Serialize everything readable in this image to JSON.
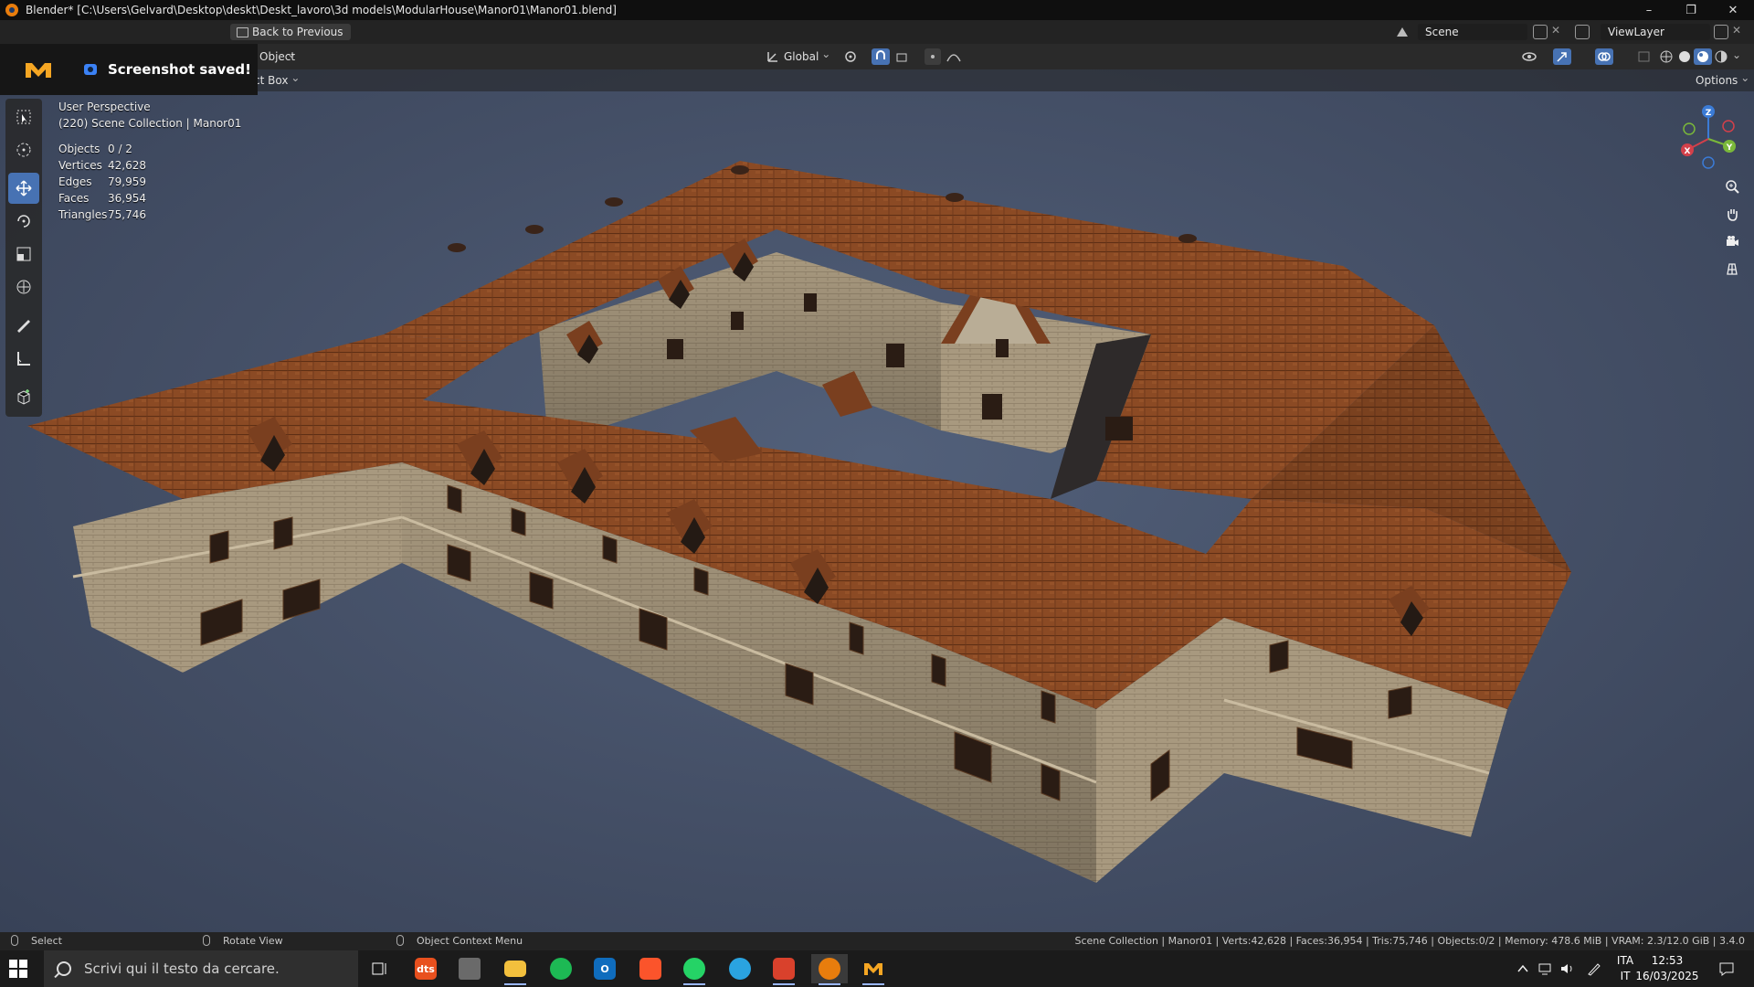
{
  "window": {
    "title": "Blender* [C:\\Users\\Gelvard\\Desktop\\deskt\\Deskt_lavoro\\3d models\\ModularHouse\\Manor01\\Manor01.blend]",
    "minimize": "–",
    "restore": "❐",
    "close": "✕"
  },
  "header": {
    "back_button": "Back to Previous",
    "scene_label": "Scene",
    "view_layer_label": "ViewLayer"
  },
  "viewport_header": {
    "mode": "Object",
    "transform_orientation": "Global",
    "select_box": "ct Box",
    "options": "Options"
  },
  "toast": {
    "message": "Screenshot saved!"
  },
  "overlay": {
    "view_name": "User Perspective",
    "collection": "(220) Scene Collection | Manor01"
  },
  "stats": [
    {
      "key": "Objects",
      "value": "0 / 2"
    },
    {
      "key": "Vertices",
      "value": "42,628"
    },
    {
      "key": "Edges",
      "value": "79,959"
    },
    {
      "key": "Faces",
      "value": "36,954"
    },
    {
      "key": "Triangles",
      "value": "75,746"
    }
  ],
  "gizmo": {
    "x": "X",
    "y": "Y",
    "z": "Z"
  },
  "statusbar": {
    "select": "Select",
    "rotate_view": "Rotate View",
    "context_menu": "Object Context Menu",
    "info": "Scene Collection | Manor01 | Verts:42,628 | Faces:36,954 | Tris:75,746 | Objects:0/2 | Memory: 478.6 MiB | VRAM: 2.3/12.0 GiB | 3.4.0"
  },
  "taskbar": {
    "search_placeholder": "Scrivi qui il testo da cercare.",
    "lang_top": "ITA",
    "lang_bottom": "IT",
    "time": "12:53",
    "date": "16/03/2025"
  },
  "colors": {
    "accent_blue": "#4772b3",
    "roof": "#8a4a25",
    "wall": "#a89880",
    "viewport_bg": "#4a556d"
  }
}
